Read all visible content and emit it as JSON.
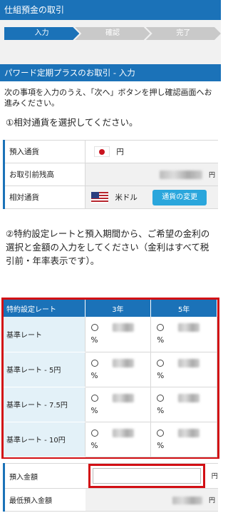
{
  "header": {
    "title": "仕組預金の取引"
  },
  "steps": [
    "入力",
    "確認",
    "完了"
  ],
  "section": {
    "title": "パワード定期プラスのお取引 - 入力"
  },
  "intro": "次の事項を入力のうえ、「次へ」ボタンを押し確認画面へお進みください。",
  "instruction1": "①相対通貨を選択してください。",
  "info": {
    "deposit_currency_label": "預入通貨",
    "deposit_currency_value": "円",
    "balance_label": "お取引前残高",
    "balance_unit": "円",
    "counter_currency_label": "相対通貨",
    "counter_currency_value": "米ドル",
    "change_button": "通貨の変更"
  },
  "instruction2": "②特約設定レートと預入期間から、ご希望の金利の選択と金額の入力をしてください（金利はすべて税引前・年率表示です）。",
  "rates": {
    "header": [
      "特約設定レート",
      "3年",
      "5年"
    ],
    "percent_symbol": "%",
    "rows": [
      {
        "label": "基準レート"
      },
      {
        "label": "基準レート - 5円"
      },
      {
        "label": "基準レート - 7.5円"
      },
      {
        "label": "基準レート - 10円"
      }
    ]
  },
  "amount": {
    "label": "預入金額",
    "value": "",
    "unit": "円",
    "min_label": "最低預入金額"
  },
  "colors": {
    "brand": "#1b72b8",
    "highlight": "#d20f14",
    "button": "#2aa6dc"
  }
}
